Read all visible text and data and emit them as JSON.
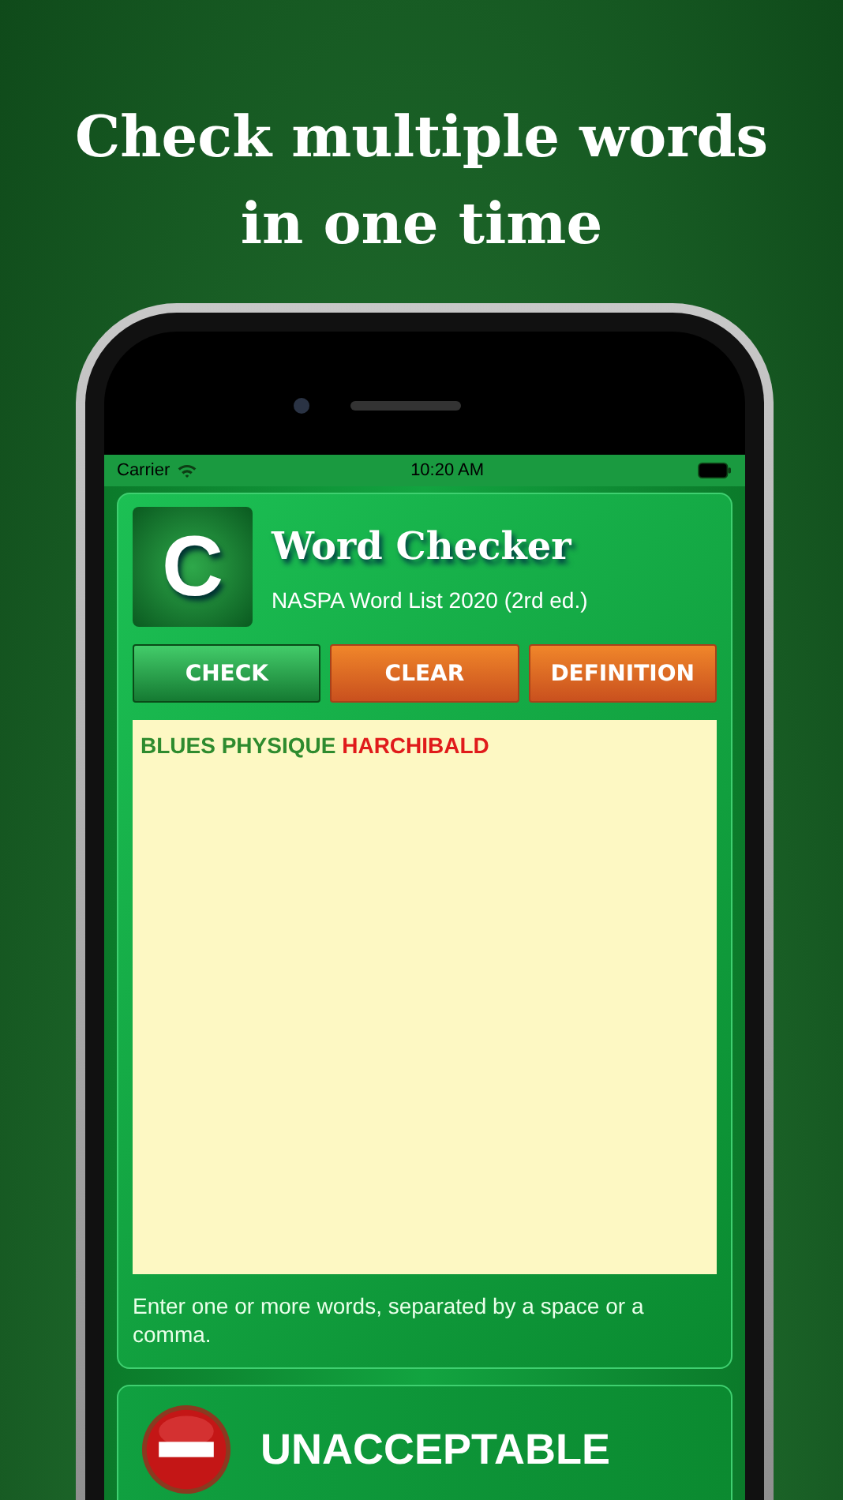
{
  "headline": "Check multiple words in one time",
  "status_bar": {
    "carrier": "Carrier",
    "time": "10:20 AM"
  },
  "app": {
    "logo_letter": "C",
    "title": "Word Checker",
    "subtitle": "NASPA Word List 2020 (2rd ed.)"
  },
  "buttons": [
    {
      "label": "CHECK",
      "kind": "primary"
    },
    {
      "label": "CLEAR",
      "kind": "secondary"
    },
    {
      "label": "DEFINITION",
      "kind": "secondary"
    }
  ],
  "words": [
    {
      "text": "BLUES",
      "color": "#2e8b2e"
    },
    {
      "text": "PHYSIQUE",
      "color": "#2e8b2e"
    },
    {
      "text": "HARCHIBALD",
      "color": "#e01b1b"
    }
  ],
  "hint": "Enter one or more words, separated by a space or a comma.",
  "result": {
    "kind": "unacceptable",
    "label": "UNACCEPTABLE"
  }
}
